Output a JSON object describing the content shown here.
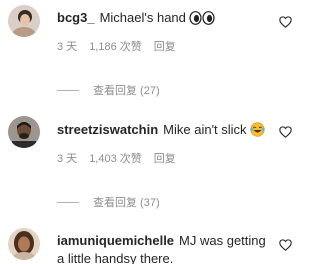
{
  "comments": [
    {
      "username": "bcg3_",
      "text": "Michael's hand",
      "emoji": "eyes",
      "time": "3 天",
      "likes": "1,186 次赞",
      "reply": "回复",
      "view_replies": "查看回复 (27)"
    },
    {
      "username": "streetziswatchin",
      "text": "Mike ain't slick",
      "emoji": "face-with-tears-of-joy",
      "time": "3 天",
      "likes": "1,403 次赞",
      "reply": "回复",
      "view_replies": "查看回复 (37)"
    },
    {
      "username": "iamuniquemichelle",
      "text": "MJ was getting a little handsy there."
    }
  ],
  "colors": {
    "text": "#262626",
    "muted": "#8e8e8e",
    "divider": "#b0b0b0",
    "background": "#ffffff"
  },
  "icons": [
    "heart-outline-icon",
    "eyes-emoji",
    "laughing-emoji"
  ]
}
